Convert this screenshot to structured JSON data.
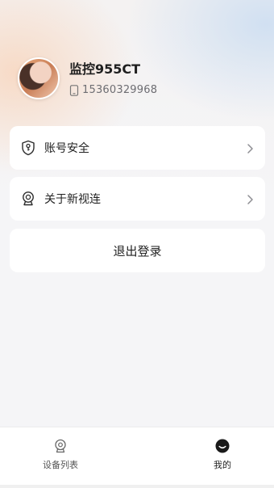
{
  "profile": {
    "name": "监控955CT",
    "phone": "15360329968"
  },
  "menu": [
    {
      "label": "账号安全",
      "icon": "shield-key-icon"
    },
    {
      "label": "关于新视连",
      "icon": "camera-icon"
    }
  ],
  "logout": {
    "label": "退出登录"
  },
  "tabbar": {
    "tabs": [
      {
        "label": "设备列表",
        "icon": "camera-icon",
        "active": false
      },
      {
        "label": "我的",
        "icon": "smile-icon",
        "active": true
      }
    ]
  }
}
